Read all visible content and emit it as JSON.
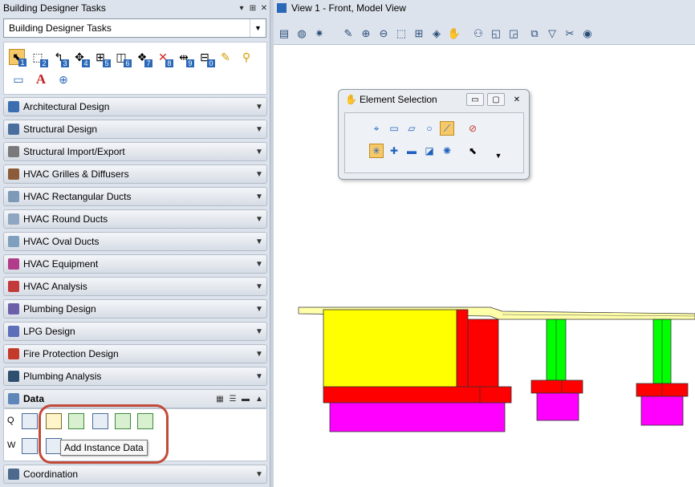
{
  "left_panel": {
    "title": "Building Designer Tasks",
    "task_dropdown": "Building Designer Tasks",
    "pin_glyph": "▾",
    "dock_glyph": "⊞",
    "close_glyph": "✕",
    "toolbox_numbers": [
      "1",
      "2",
      "3",
      "4",
      "5",
      "6",
      "7",
      "8",
      "9",
      "0"
    ],
    "categories": [
      {
        "label": "Architectural Design",
        "color": "#3d6fb0"
      },
      {
        "label": "Structural Design",
        "color": "#4a6f9e"
      },
      {
        "label": "Structural Import/Export",
        "color": "#7a7a7a"
      },
      {
        "label": "HVAC Grilles & Diffusers",
        "color": "#8c5b3a"
      },
      {
        "label": "HVAC Rectangular Ducts",
        "color": "#7d9ab8"
      },
      {
        "label": "HVAC Round Ducts",
        "color": "#8ea6c2"
      },
      {
        "label": "HVAC Oval Ducts",
        "color": "#7f9fbf"
      },
      {
        "label": "HVAC Equipment",
        "color": "#b03c8a"
      },
      {
        "label": "HVAC Analysis",
        "color": "#c23a3a"
      },
      {
        "label": "Plumbing Design",
        "color": "#6a5fa8"
      },
      {
        "label": "LPG Design",
        "color": "#5c6fb8"
      },
      {
        "label": "Fire Protection Design",
        "color": "#c43a2a"
      },
      {
        "label": "Plumbing Analysis",
        "color": "#2f4f6f"
      }
    ],
    "data_section": {
      "label": "Data",
      "row_q": "Q",
      "row_w": "W",
      "tooltip": "Add Instance Data"
    },
    "coordination": "Coordination"
  },
  "view": {
    "title": "View 1 - Front, Model View"
  },
  "element_selection": {
    "title": "Element Selection"
  },
  "colors": {
    "slab": "#ffff00",
    "red": "#ff0000",
    "green": "#00ff00",
    "magenta": "#ff00ff",
    "accent": "#c24a3a"
  }
}
